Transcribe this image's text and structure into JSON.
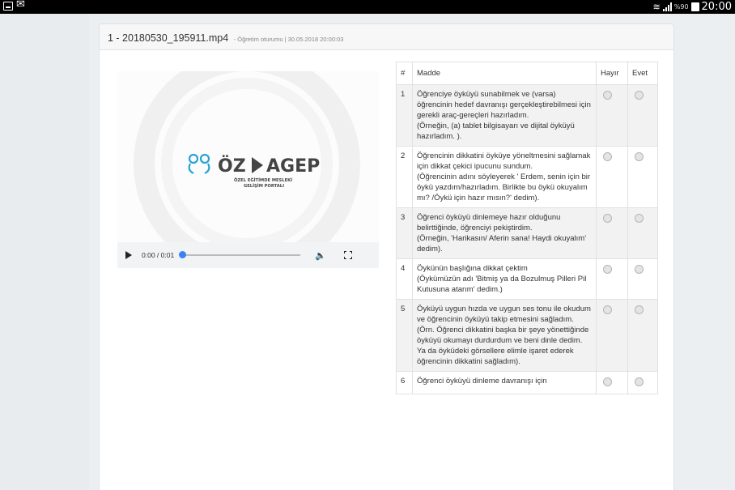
{
  "status_bar": {
    "left_icons": [
      "app-icon",
      "mail-icon"
    ],
    "battery": "%90",
    "time": "20:00"
  },
  "header": {
    "title": "1 - 20180530_195911.mp4",
    "subtitle": "- Öğretim oturumu | 30.05.2018 20:00:03"
  },
  "video": {
    "logo_text": "ÖZEL EĞİTİMDE MESLEKİ GELİŞİM PORTALI",
    "time_display": "0:00 / 0:01",
    "progress": 0
  },
  "table": {
    "headers": [
      "#",
      "Madde",
      "Hayır",
      "Evet"
    ],
    "rows": [
      {
        "num": "1",
        "text": "Öğrenciye öyküyü sunabilmek ve (varsa) öğrencinin hedef davranışı gerçekleştirebilmesi için gerekli araç-gereçleri hazırladım.\n(Örneğin, (a) tablet bilgisayarı ve dijital öyküyü hazırladım. )."
      },
      {
        "num": "2",
        "text": "Öğrencinin dikkatini öyküye yöneltmesini sağlamak için dikkat çekici ipucunu sundum.\n (Öğrencinin adını söyleyerek ' Erdem, senin için bir öykü yazdım/hazırladım. Birlikte bu öykü okuyalım mı? /Öykü için hazır mısın?' dedim)."
      },
      {
        "num": "3",
        "text": "Öğrenci öyküyü dinlemeye hazır olduğunu belirttiğinde, öğrenciyi pekiştirdim.\n(Örneğin, 'Harikasın/ Aferin sana! Haydi okuyalım' dedim)."
      },
      {
        "num": "4",
        "text": "Öykünün başlığına dikkat çektim\n(Öykümüzün adı 'Bitmiş ya da Bozulmuş Pilleri Pil Kutusuna atarım' dedim.)"
      },
      {
        "num": "5",
        "text": "Öyküyü uygun hızda ve uygun ses tonu ile okudum ve öğrencinin öyküyü takip etmesini sağladım.\n(Örn. Öğrenci dikkatini başka bir şeye yönettiğinde öyküyü okumayı durdurdum ve beni dinle dedim. Ya da öyküdeki görsellere elimle işaret ederek öğrencinin dikkatini sağladım)."
      },
      {
        "num": "6",
        "text": "Öğrenci öyküyü dinleme davranışı için"
      }
    ]
  }
}
